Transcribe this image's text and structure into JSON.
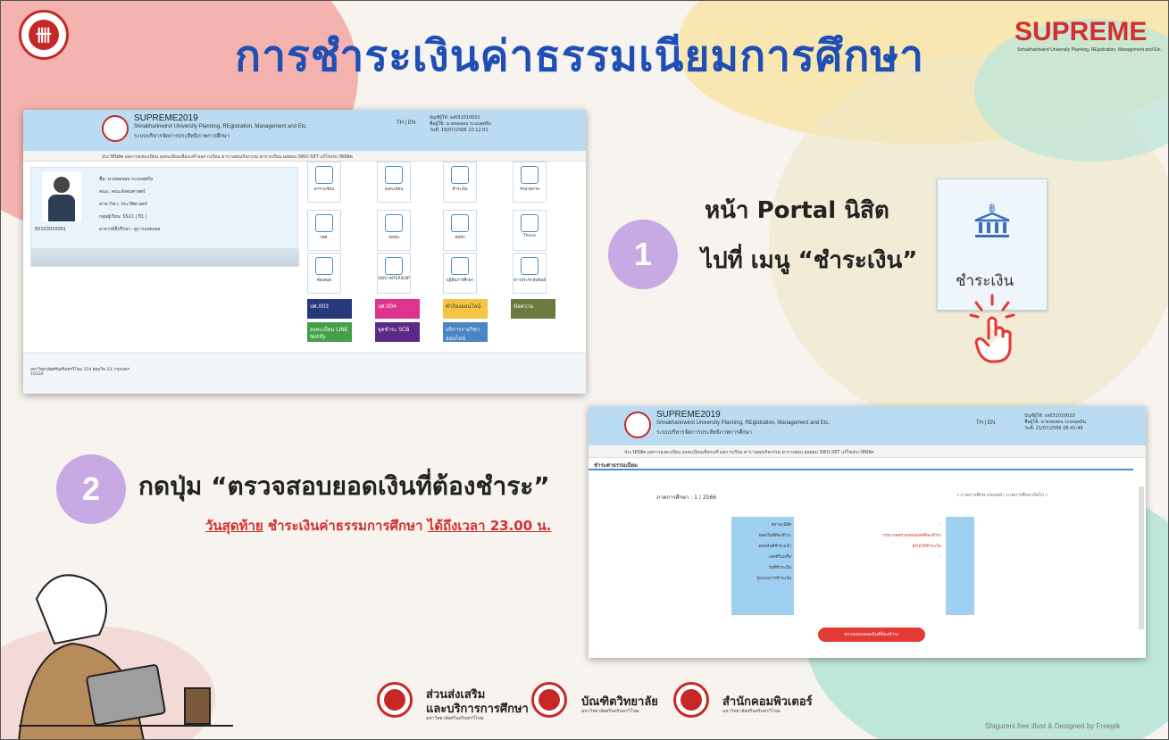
{
  "header": {
    "title": "การชำระเงินค่าธรรมเนียมการศึกษา",
    "brand": "SUPREME",
    "brand_sub": "Srinakharinwirot University Planning, REgistration, Management and Etc."
  },
  "step1": {
    "number": "1",
    "line1": "หน้า Portal นิสิต",
    "line2": "ไปที่ เมนู “ชำระเงิน”",
    "icon_label": "ชำระเงิน"
  },
  "step2": {
    "number": "2",
    "text": "กดปุ่ม “ตรวจสอบยอดเงินที่ต้องชำระ”",
    "deadline_a": "วันสุดท้าย",
    "deadline_b": " ชำระเงินค่าธรรมการศึกษา ",
    "deadline_c": "ได้ถึงเวลา 23.00 น."
  },
  "portal": {
    "system_name": "SUPREME2019",
    "system_full": "Srinakharinwirot University Planning, REgistration, Management and Etc.",
    "system_thai": "ระบบบริหารจัดการประสิทธิภาพการศึกษา",
    "lang": "TH | EN",
    "user_line1": "บัญชีผู้ใช้: ss631010001",
    "user_line2": "ชื่อผู้ใช้: นายทดสอบ ระบบสุพรีม",
    "user_line3": "วันที่: 19/07/2566 10:12:01",
    "nav": "ประวัตินิสิต   ผลการลงทะเบียน   ลงทะเบียนเลือกเสรี   ผลการเรียน   ตารางสอบกิจกรรม   ตารางเรียน   ผลสอบ SWU-SET   แก้ไขประวัตินิสิต",
    "student_id": "65103010001",
    "fields": [
      "ชื่อ: นายทดสอบ ระบบสุพรีม",
      "คณะ: คณะสังคมศาสตร์",
      "สาขาวิชา: ประวัติศาสตร์",
      "กลุ่มผู้เรียน: SS11 | ปี1 |",
      "อาจารย์ที่ปรึกษา: ดูการแสดงผล"
    ],
    "tiles": [
      "ตารางเรียน",
      "ลงทะเบียน",
      "ชำระเงิน",
      "รักษาสภาพ",
      "กยศ.",
      "ขอทุน",
      "หอพัก",
      "Thesis",
      "ห้องสมุด",
      "SWU INTERSHIP",
      "ปฏิทินการศึกษา",
      "ข่าวประชาสัมพันธ์"
    ],
    "buttons": [
      "ปศ.003",
      "ปศ.004",
      "คำร้องออนไลน์",
      "ข้อความ",
      "ลงทะเบียน LINE Notify",
      "จุดชำระ SCB",
      "บริการรายวิชาออนไลน์"
    ],
    "footer_addr": "มหาวิทยาลัยศรีนครินทรวิโรฒ 114 สุขุมวิท 23, กรุงเทพฯ 10110"
  },
  "payment": {
    "system_name": "SUPREME2019",
    "system_full": "Srinakharinwirot University Planning, REgistration, Management and Etc.",
    "system_thai": "ระบบบริหารจัดการประสิทธิภาพการศึกษา",
    "lang": "TH | EN",
    "user_line1": "บัญชีผู้ใช้: ss631010020",
    "user_line2": "ชื่อผู้ใช้: นายทดสอบ ระบบสุพรีม",
    "user_line3": "วันที่: 21/07/2566 08:41:46",
    "nav": "ประวัตินิสิต   ผลการลงทะเบียน   ลงทะเบียนเลือกเสรี   ผลการเรียน   ตารางสอบกิจกรรม   ตารางสอน   ผลสอบ SWU-SET   แก้ไขประวัตินิสิต",
    "section": "ชำระค่าธรรมเนียม",
    "semester": "ภาคการศึกษา : 1 / 2566",
    "prev_next": "« ภาคการศึกษาก่อนหน้า   ภาคการศึกษาถัดไป »",
    "rows": [
      "สถานะนิสิต",
      "ยอดเงินที่ต้องชำระ",
      "ยอดเงินที่ชำระแล้ว",
      "เลขที่ใบเสร็จ",
      "วันที่ชำระเงิน",
      "รูปแบบการชำระเงิน"
    ],
    "values": [
      "-",
      "กรุณากดตรวจสอบยอดที่ต้องชำระ",
      "ยังไม่ได้ชำระเงิน",
      "-",
      "",
      ""
    ],
    "button": "ตรวจสอบยอดเงินที่ต้องชำระ"
  },
  "footer_logos": [
    {
      "title1": "ส่วนส่งเสริม",
      "title2": "และบริการการศึกษา",
      "sub": "มหาวิทยาลัยศรีนครินทรวิโรฒ"
    },
    {
      "title1": "บัณฑิตวิทยาลัย",
      "title2": "",
      "sub": "มหาวิทยาลัยศรีนครินทรวิโรฒ"
    },
    {
      "title1": "สำนักคอมพิวเตอร์",
      "title2": "",
      "sub": "มหาวิทยาลัยศรีนครินทรวิโรฒ"
    }
  ],
  "credit": "Shigureni free illust & Designed by Freepik",
  "colors": {
    "title": "#1f4fb5",
    "brand": "#d32f2f",
    "accent": "#c7a9e3",
    "deadline": "#d32f2f"
  }
}
